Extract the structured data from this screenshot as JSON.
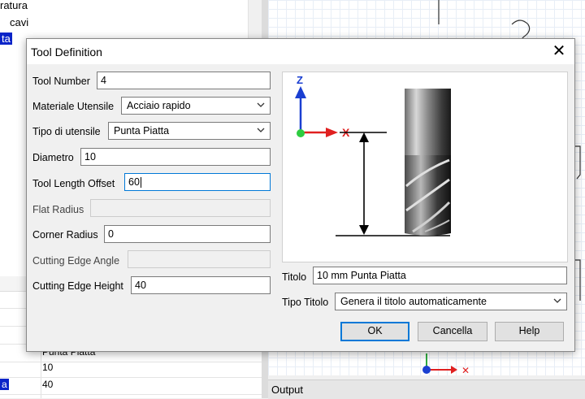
{
  "background": {
    "tree_items": [
      "ratura",
      "cavi",
      "ta"
    ],
    "grid_rows": [
      "Punta Piatta",
      "10",
      "40"
    ],
    "grid_row_labels": [
      "",
      "",
      "a"
    ],
    "output_label": "Output"
  },
  "dialog": {
    "title": "Tool Definition",
    "close_glyph": "✕",
    "fields": {
      "tool_number": {
        "label": "Tool Number",
        "value": "4"
      },
      "materiale": {
        "label": "Materiale Utensile",
        "value": "Acciaio rapido"
      },
      "tipo": {
        "label": "Tipo di utensile",
        "value": "Punta Piatta"
      },
      "diametro": {
        "label": "Diametro",
        "value": "10"
      },
      "tool_length_offset": {
        "label": "Tool Length Offset",
        "value": "60"
      },
      "flat_radius": {
        "label": "Flat Radius",
        "value": ""
      },
      "corner_radius": {
        "label": "Corner Radius",
        "value": "0"
      },
      "cutting_edge_angle": {
        "label": "Cutting Edge Angle",
        "value": ""
      },
      "cutting_edge_height": {
        "label": "Cutting Edge Height",
        "value": "40"
      }
    },
    "titolo": {
      "label": "Titolo",
      "value": "10 mm Punta Piatta"
    },
    "tipo_titolo": {
      "label": "Tipo Titolo",
      "value": "Genera il titolo automaticamente"
    },
    "preview": {
      "axis_z": "Z",
      "axis_x": "X"
    },
    "buttons": {
      "ok": "OK",
      "cancel": "Cancella",
      "help": "Help"
    }
  },
  "colors": {
    "accent": "#0078d7",
    "axis_z": "#1a3fd1",
    "axis_x": "#e02020",
    "origin": "#2ecc40",
    "selection": "#0a24c8"
  }
}
